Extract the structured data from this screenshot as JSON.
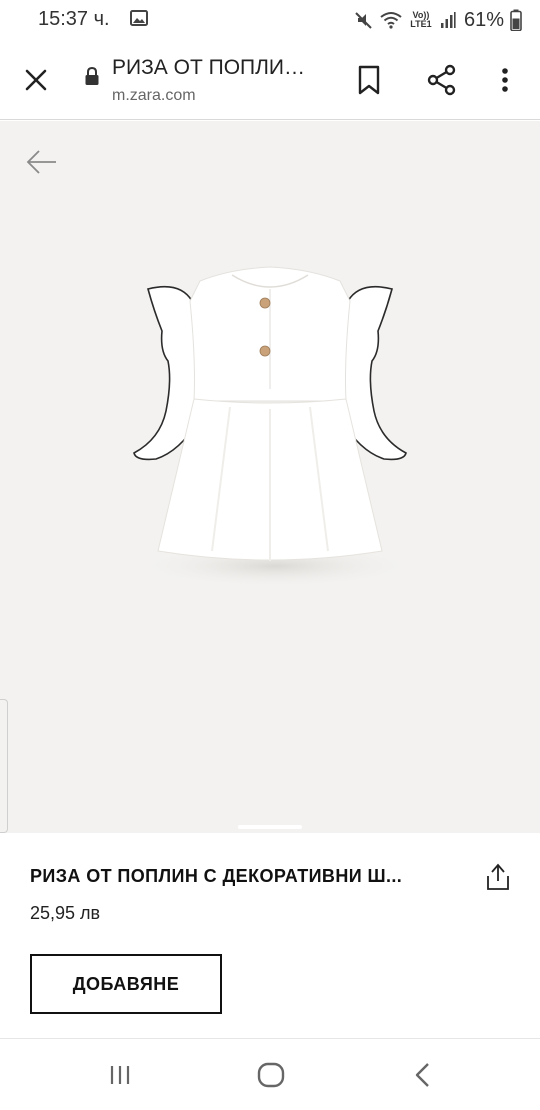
{
  "status_bar": {
    "time": "15:37 ч.",
    "network": "Vo)) LTE1",
    "battery": "61%",
    "icons": [
      "gallery-icon",
      "mute-icon",
      "wifi-icon",
      "signal-icon",
      "battery-icon"
    ]
  },
  "browser": {
    "title": "РИЗА ОТ ПОПЛИ…",
    "url": "m.zara.com",
    "icons": [
      "close-icon",
      "lock-icon",
      "bookmark-icon",
      "share-icon",
      "more-vert-icon"
    ]
  },
  "product": {
    "name": "РИЗА ОТ ПОПЛИН С ДЕКОРАТИВНИ Ш...",
    "price": "25,95 лв",
    "add_button": "ДОБАВЯНЕ",
    "image": "white-poplin-ruffle-shirt",
    "colors": {
      "background": "#f3f2f0",
      "garment": "#ffffff",
      "buttons": "#c9a27a"
    }
  },
  "nav": {
    "icons": [
      "recents-icon",
      "home-icon",
      "back-icon"
    ]
  }
}
